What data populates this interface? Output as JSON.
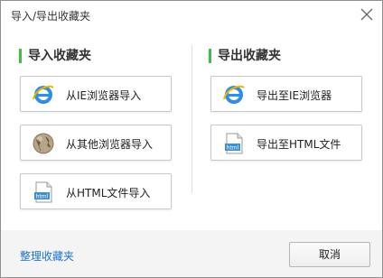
{
  "dialog": {
    "title": "导入/导出收藏夹"
  },
  "import_section": {
    "title": "导入收藏夹",
    "buttons": [
      {
        "label": "从IE浏览器导入",
        "icon": "ie-icon"
      },
      {
        "label": "从其他浏览器导入",
        "icon": "globe-icon"
      },
      {
        "label": "从HTML文件导入",
        "icon": "html-file-icon"
      }
    ]
  },
  "export_section": {
    "title": "导出收藏夹",
    "buttons": [
      {
        "label": "导出至IE浏览器",
        "icon": "ie-icon"
      },
      {
        "label": "导出至HTML文件",
        "icon": "html-file-icon"
      }
    ]
  },
  "footer": {
    "organize_link": "整理收藏夹",
    "cancel_label": "取消"
  },
  "colors": {
    "accent_green": "#3fbf4a",
    "link_blue": "#1a73d1"
  }
}
